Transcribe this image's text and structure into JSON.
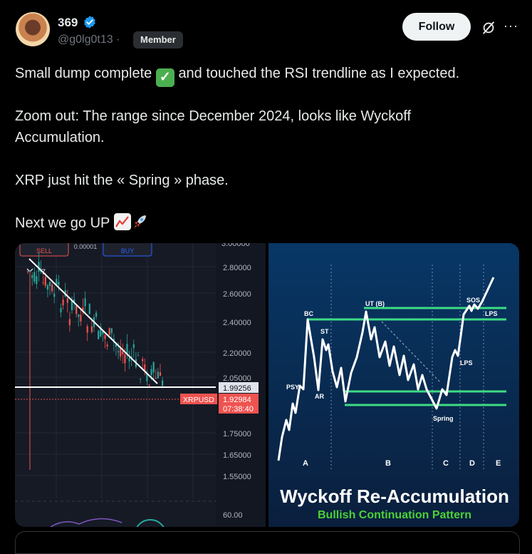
{
  "author": {
    "name": "369",
    "handle": "@g0lg0t13",
    "separator": "·",
    "badge": "Member",
    "verified_color": "#1d9bf0"
  },
  "actions": {
    "follow_label": "Follow",
    "grok_icon": "grok-icon",
    "more_label": "···"
  },
  "post": {
    "line1_a": "Small dump complete",
    "line1_check": "✓",
    "line1_b": "and touched the RSI trendline as I expected.",
    "line2": "Zoom out: The range since December 2024, looks like Wyckoff",
    "line3": "Accumulation.",
    "line4": "XRP just hit the « Spring » phase.",
    "line5": "Next we go UP"
  },
  "trading_chart": {
    "sell_label": "SELL",
    "buy_label": "BUY",
    "spread": "0.00001",
    "indicator_count": "7",
    "price_ticks": [
      "2.80000",
      "2.60000",
      "2.40000",
      "2.20000",
      "2.05000",
      "1.75000",
      "1.65000",
      "1.55000"
    ],
    "rsi_tick": "60.00",
    "line_price": "1.99256",
    "symbol": "XRPUSD",
    "last_price": "1.92984",
    "countdown": "07:38:40",
    "colors": {
      "up": "#26a69a",
      "down": "#ef5350",
      "bg": "#161a25"
    }
  },
  "wyckoff": {
    "title": "Wyckoff Re-Accumulation",
    "subtitle": "Bullish Continuation Pattern",
    "labels": {
      "bc": "BC",
      "ut": "UT (B)",
      "st": "ST",
      "psy": "PSY",
      "ar": "AR",
      "spring": "Spring",
      "sos": "SOS",
      "lps": "LPS",
      "lps2": "LPS"
    },
    "phases": [
      "A",
      "B",
      "C",
      "D",
      "E"
    ],
    "colors": {
      "bg": "#0d2a52",
      "line": "#3ddc84",
      "path": "#ffffff",
      "subtitle": "#4cd137"
    }
  }
}
